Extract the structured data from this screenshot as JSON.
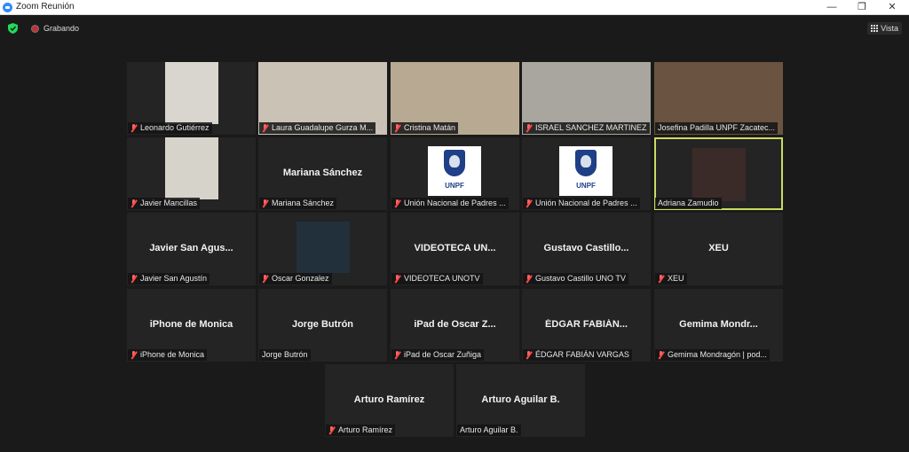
{
  "window": {
    "title": "Zoom Reunión"
  },
  "topbar": {
    "recording_label": "Grabando",
    "view_label": "Vista"
  },
  "tiles": [
    {
      "label": "Leonardo Gutiérrez",
      "muted": true,
      "type": "video",
      "bg": "#d9d6cf"
    },
    {
      "label": "Laura Guadalupe Gurza M...",
      "muted": true,
      "type": "video",
      "bg": "#c9c2b5"
    },
    {
      "label": "Cristina Matán",
      "muted": true,
      "type": "video",
      "bg": "#b8aa92"
    },
    {
      "label": "ISRAEL SANCHEZ MARTINEZ",
      "muted": true,
      "type": "video",
      "bg": "#a9a6a0"
    },
    {
      "label": "Josefina Padilla UNPF Zacatec...",
      "muted": false,
      "type": "video",
      "bg": "#6a5340"
    },
    {
      "label": "Javier Mancillas",
      "muted": true,
      "type": "video",
      "bg": "#d6d3cb"
    },
    {
      "label": "Mariana Sánchez",
      "muted": true,
      "type": "name",
      "name": "Mariana Sánchez"
    },
    {
      "label": "Unión Nacional de Padres ...",
      "muted": true,
      "type": "logo",
      "logo_text": "UNPF"
    },
    {
      "label": "Unión Nacional de Padres ...",
      "muted": true,
      "type": "logo",
      "logo_text": "UNPF"
    },
    {
      "label": "Adriana Zamudio",
      "muted": false,
      "type": "video",
      "bg": "#3a2a28",
      "active": true
    },
    {
      "label": "Javier San Agustín",
      "muted": true,
      "type": "name",
      "name": "Javier San Agus..."
    },
    {
      "label": "Oscar Gonzalez",
      "muted": true,
      "type": "video",
      "bg": "#22303b"
    },
    {
      "label": "VIDEOTECA UNOTV",
      "muted": true,
      "type": "name",
      "name": "VIDEOTECA UN..."
    },
    {
      "label": "Gustavo Castillo UNO TV",
      "muted": true,
      "type": "name",
      "name": "Gustavo Castillo..."
    },
    {
      "label": "XEU",
      "muted": true,
      "type": "name",
      "name": "XEU"
    },
    {
      "label": "iPhone de Monica",
      "muted": true,
      "type": "name",
      "name": "iPhone de Monica"
    },
    {
      "label": "Jorge Butrón",
      "muted": false,
      "type": "name",
      "name": "Jorge Butrón"
    },
    {
      "label": "iPad de Oscar Zuñiga",
      "muted": true,
      "type": "name",
      "name": "iPad de Oscar Z..."
    },
    {
      "label": "ÉDGAR FABIÁN VARGAS",
      "muted": true,
      "type": "name",
      "name": "ÉDGAR FABIÁN..."
    },
    {
      "label": "Gemima Mondragón | pod...",
      "muted": true,
      "type": "name",
      "name": "Gemima Mondr..."
    },
    {
      "label": "Arturo Ramírez",
      "muted": true,
      "type": "name",
      "name": "Arturo Ramírez"
    },
    {
      "label": "Arturo Aguilar B.",
      "muted": false,
      "type": "name",
      "name": "Arturo Aguilar B."
    }
  ],
  "colors": {
    "accent": "#2d8cff",
    "active_border": "#c9dc61",
    "muted_icon": "#ff5050",
    "background": "#1a1a1a",
    "tile": "#242424"
  }
}
